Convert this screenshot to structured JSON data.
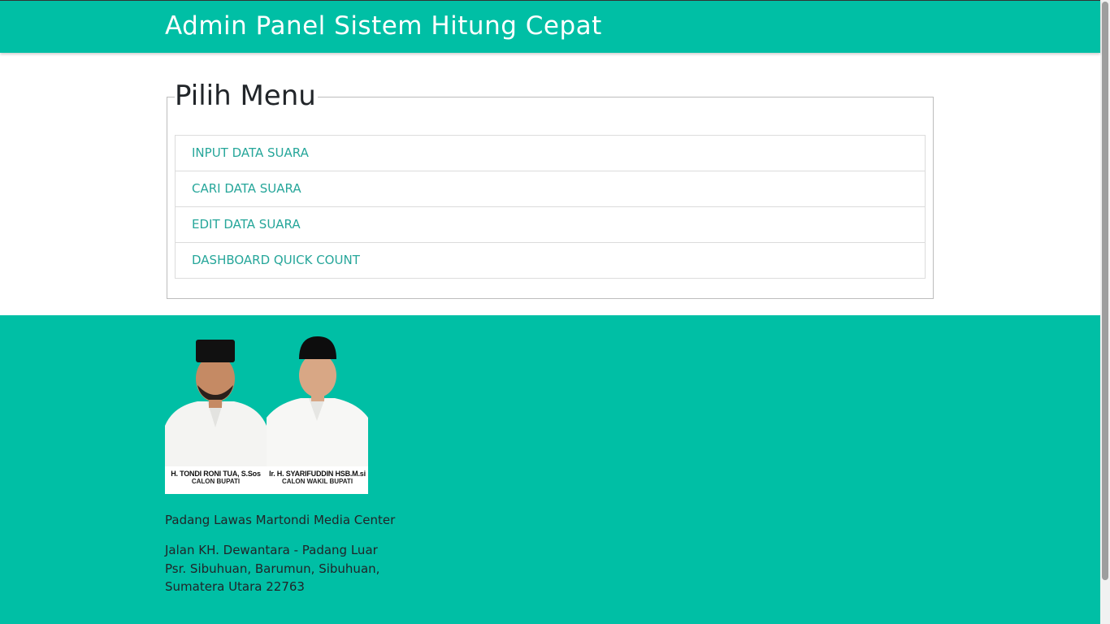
{
  "header": {
    "title": "Admin Panel Sistem Hitung Cepat"
  },
  "menu": {
    "legend": "Pilih Menu",
    "items": [
      {
        "label": "INPUT DATA SUARA"
      },
      {
        "label": "CARI DATA SUARA"
      },
      {
        "label": "EDIT DATA SUARA"
      },
      {
        "label": "DASHBOARD QUICK COUNT"
      }
    ]
  },
  "footer": {
    "candidates": [
      {
        "name": "H. TONDI RONI TUA, S.Sos",
        "role": "CALON BUPATI"
      },
      {
        "name": "Ir. H. SYARIFUDDIN HSB.M.si",
        "role": "CALON WAKIL BUPATI"
      }
    ],
    "org_name": "Padang Lawas Martondi Media Center",
    "address_line1": "Jalan KH. Dewantara - Padang Luar",
    "address_line2": "Psr. Sibuhuan, Barumun, Sibuhuan,",
    "address_line3": "Sumatera Utara 22763"
  },
  "colors": {
    "primary": "#00bfa5",
    "link": "#26a69a"
  }
}
